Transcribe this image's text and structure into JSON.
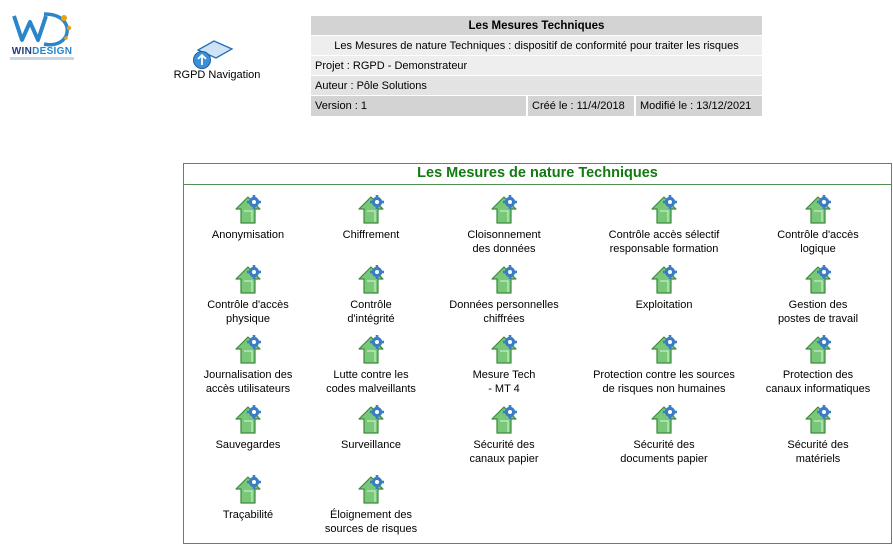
{
  "logo": {
    "brand_part1": "WIN",
    "brand_part2": "DESIGN"
  },
  "navigation": {
    "label": "RGPD Navigation"
  },
  "header": {
    "title": "Les Mesures Techniques",
    "subtitle": "Les Mesures de nature Techniques : dispositif de conformité pour traiter les risques",
    "project": "Projet : RGPD - Demonstrateur",
    "author": "Auteur : Pôle Solutions",
    "version": "Version : 1",
    "created": "Créé le : 11/4/2018",
    "modified": "Modifié le : 13/12/2021"
  },
  "panel": {
    "title": "Les Mesures de nature Techniques",
    "items": [
      "Anonymisation",
      "Chiffrement",
      "Cloisonnement\ndes données",
      "Contrôle accès sélectif\nresponsable formation",
      "Contrôle d'accès\nlogique",
      "Contrôle d'accès\nphysique",
      "Contrôle\nd'intégrité",
      "Données personnelles\nchiffrées",
      "Exploitation",
      "Gestion des\npostes de travail",
      "Journalisation des\naccès utilisateurs",
      "Lutte contre les\ncodes malveillants",
      "Mesure Tech\n- MT 4",
      "Protection contre les sources\nde risques non humaines",
      "Protection des\ncanaux informatiques",
      "Sauvegardes",
      "Surveillance",
      "Sécurité des\ncanaux papier",
      "Sécurité des\ndocuments papier",
      "Sécurité des\nmatériels",
      "Traçabilité",
      "Éloignement des\nsources de risques"
    ],
    "item_icon": "house-gear-icon"
  },
  "colors": {
    "panel_border": "#4f8f4f",
    "panel_title": "#137a13",
    "icon_green": "#6fbf6f",
    "icon_gear": "#3b7dc4"
  }
}
